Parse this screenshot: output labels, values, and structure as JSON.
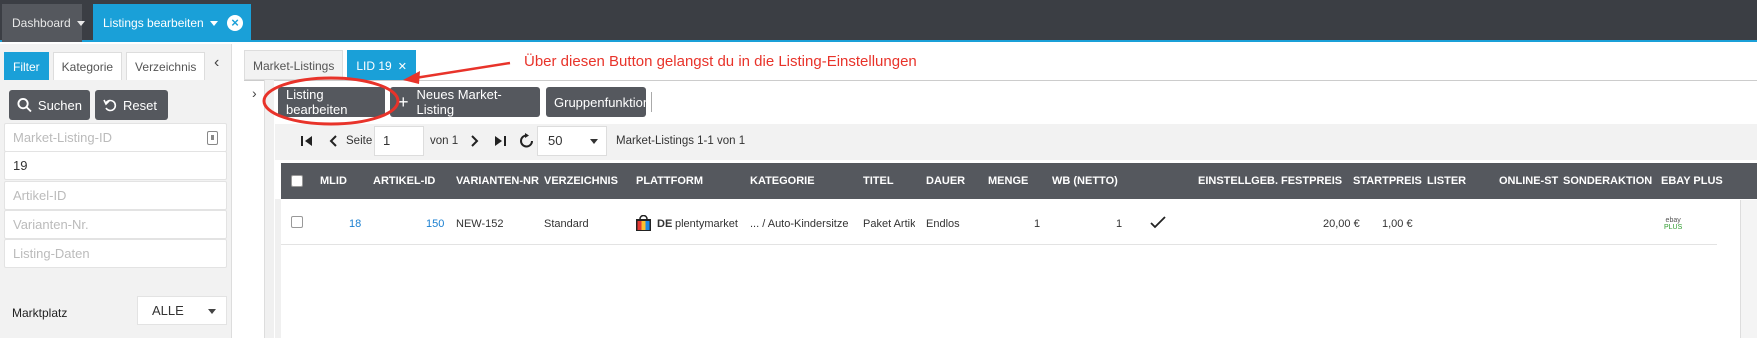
{
  "topbar": {
    "tabs": [
      {
        "label": "Dashboard"
      },
      {
        "label": "Listings bearbeiten"
      }
    ]
  },
  "left_panel": {
    "tabs": [
      {
        "label": "Filter"
      },
      {
        "label": "Kategorie"
      },
      {
        "label": "Verzeichnis"
      }
    ],
    "search_label": "Suchen",
    "reset_label": "Reset",
    "fields": [
      {
        "placeholder": "Market-Listing-ID",
        "value": ""
      },
      {
        "placeholder": "",
        "value": "19"
      },
      {
        "placeholder": "Artikel-ID",
        "value": ""
      },
      {
        "placeholder": "Varianten-Nr.",
        "value": ""
      },
      {
        "placeholder": "Listing-Daten",
        "value": ""
      }
    ],
    "marketplace_label": "Marktplatz",
    "marketplace_value": "ALLE"
  },
  "main": {
    "tabs": [
      {
        "label": "Market-Listings"
      },
      {
        "label": "LID 19"
      }
    ],
    "buttons": {
      "edit": "Listing bearbeiten",
      "new": "Neues Market-Listing",
      "group": "Gruppenfunktion"
    },
    "pagination": {
      "page_label": "Seite",
      "page_value": "1",
      "of_label": "von 1",
      "per_page": "50",
      "summary": "Market-Listings  1-1 von 1"
    },
    "columns": [
      "MLID",
      "ARTIKEL-ID",
      "VARIANTEN-NR",
      "VERZEICHNIS",
      "PLATTFORM",
      "KATEGORIE",
      "TITEL",
      "DAUER",
      "MENGE",
      "WB (NETTO)",
      "EINSTELLGEB.",
      "FESTPREIS",
      "STARTPREIS",
      "LISTER",
      "ONLINE-ST",
      "SONDERAKTION",
      "EBAY PLUS"
    ],
    "rows": [
      {
        "mlid": "18",
        "artikel_id": "150",
        "varianten_nr": "NEW-152",
        "verzeichnis": "Standard",
        "plattform_country": "DE",
        "plattform_name": "plentymarket",
        "kategorie": "... / Auto-Kindersitze",
        "titel": "Paket Artik",
        "dauer": "Endlos",
        "menge": "1",
        "wb": "1",
        "festpreis": "20,00 €",
        "startpreis": "1,00 €",
        "ebay_plus_top": "ebay",
        "ebay_plus_bottom": "PLUS"
      }
    ]
  },
  "annotation": {
    "text": "Über diesen Button gelangst du in die Listing-Einstellungen",
    "color": "#e8332a"
  },
  "colors": {
    "accent": "#1aa0d8",
    "dark_button": "#55585e",
    "topbar": "#3b3e44",
    "link": "#1a7fd0"
  }
}
